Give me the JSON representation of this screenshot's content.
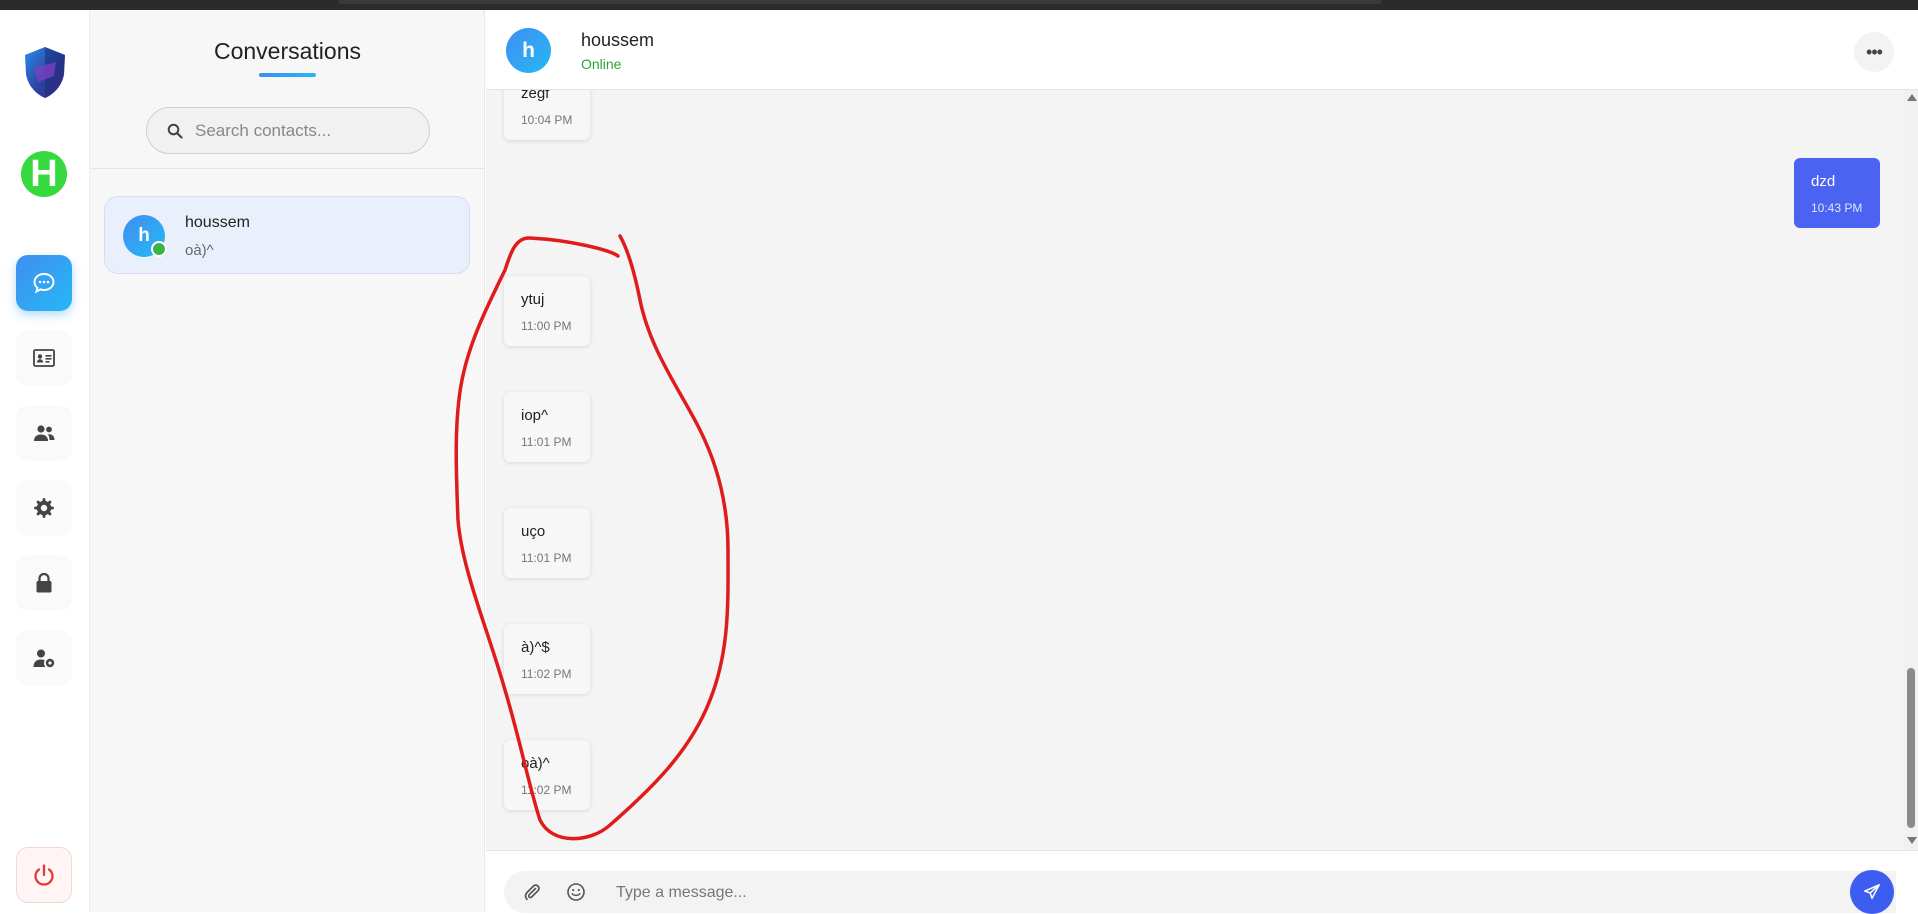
{
  "sidebar": {
    "logo_name": "shield-logo",
    "user_initial": "H",
    "items": [
      {
        "name": "chat",
        "icon": "chat-bubble-icon",
        "active": true
      },
      {
        "name": "id-card",
        "icon": "id-card-icon",
        "active": false
      },
      {
        "name": "users",
        "icon": "users-icon",
        "active": false
      },
      {
        "name": "settings",
        "icon": "gear-icon",
        "active": false
      },
      {
        "name": "lock",
        "icon": "lock-icon",
        "active": false
      },
      {
        "name": "user-settings",
        "icon": "user-gear-icon",
        "active": false
      }
    ],
    "logout_icon": "power-icon"
  },
  "conversations": {
    "title": "Conversations",
    "search_placeholder": "Search contacts...",
    "contacts": [
      {
        "initial": "h",
        "name": "houssem",
        "last_message": "oà)^",
        "online": true
      }
    ]
  },
  "chat": {
    "contact_initial": "h",
    "contact_name": "houssem",
    "status": "Online",
    "messages": [
      {
        "direction": "in",
        "text": "zegf",
        "time": "10:04 PM"
      },
      {
        "direction": "out",
        "text": "dzd",
        "time": "10:43 PM"
      },
      {
        "direction": "in",
        "text": "ytuj",
        "time": "11:00 PM"
      },
      {
        "direction": "in",
        "text": "iop^",
        "time": "11:01 PM"
      },
      {
        "direction": "in",
        "text": "uço",
        "time": "11:01 PM"
      },
      {
        "direction": "in",
        "text": "à)^$",
        "time": "11:02 PM"
      },
      {
        "direction": "in",
        "text": "oà)^",
        "time": "11:02 PM"
      }
    ],
    "composer_placeholder": "Type a message..."
  },
  "colors": {
    "accent": "#3f8ef0",
    "outgoing_bubble": "#4a63f0",
    "online": "#2aa33a",
    "annotation_stroke": "#e01b1b"
  }
}
